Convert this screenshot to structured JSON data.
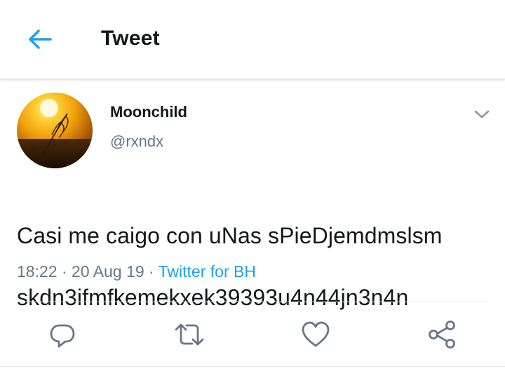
{
  "header": {
    "title": "Tweet",
    "back_icon": "arrow-left-icon"
  },
  "tweet": {
    "author": {
      "display_name": "Moonchild",
      "handle": "@rxndx"
    },
    "text_line1": "Casi me caigo con uNas sPieDjemdmslsm",
    "text_line2": "skdn3ifmfkemekxek39393u4n44jn3n4n",
    "time": "18:22",
    "separator1": " · ",
    "date": "20 Aug 19",
    "separator2": " · ",
    "source": "Twitter for BH"
  },
  "actions": [
    "reply-icon",
    "retweet-icon",
    "like-icon",
    "share-icon"
  ],
  "colors": {
    "accent": "#1da1f2",
    "text": "#14171a",
    "secondary": "#657786",
    "icon": "#657786",
    "divider": "#e1e8ed"
  }
}
